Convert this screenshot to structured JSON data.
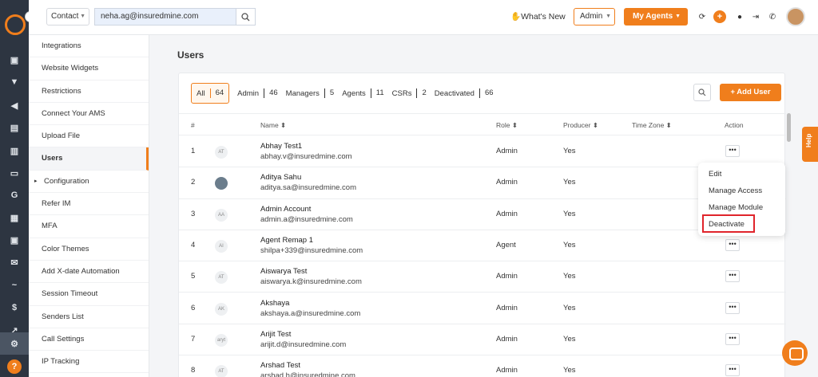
{
  "header": {
    "search_scope": "Contact",
    "search_value": "neha.ag@insuredmine.com",
    "whats_new": "What's New",
    "role": "Admin",
    "my_agents": "My Agents",
    "accent": "#f07e1c"
  },
  "settings_nav": [
    {
      "label": "Integrations"
    },
    {
      "label": "Website Widgets"
    },
    {
      "label": "Restrictions"
    },
    {
      "label": "Connect Your AMS"
    },
    {
      "label": "Upload File"
    },
    {
      "label": "Users",
      "active": true
    },
    {
      "label": "Configuration",
      "expandable": true
    },
    {
      "label": "Refer IM"
    },
    {
      "label": "MFA"
    },
    {
      "label": "Color Themes"
    },
    {
      "label": "Add X-date Automation"
    },
    {
      "label": "Session Timeout"
    },
    {
      "label": "Senders List"
    },
    {
      "label": "Call Settings"
    },
    {
      "label": "IP Tracking"
    }
  ],
  "page": {
    "title": "Users",
    "add_user": "Add User",
    "tabs": [
      {
        "label": "All",
        "count": "64"
      },
      {
        "label": "Admin",
        "count": "46"
      },
      {
        "label": "Managers",
        "count": "5"
      },
      {
        "label": "Agents",
        "count": "11"
      },
      {
        "label": "CSRs",
        "count": "2"
      },
      {
        "label": "Deactivated",
        "count": "66"
      }
    ]
  },
  "table": {
    "columns": [
      "#",
      "Name",
      "Role",
      "Producer",
      "Time Zone",
      "Action"
    ],
    "rows": [
      {
        "num": "1",
        "initials": "AT",
        "name": "Abhay Test1",
        "email": "abhay.v@insuredmine.com",
        "role": "Admin",
        "producer": "Yes"
      },
      {
        "num": "2",
        "initials": "",
        "name": "Aditya Sahu",
        "email": "aditya.sa@insuredmine.com",
        "role": "Admin",
        "producer": "Yes"
      },
      {
        "num": "3",
        "initials": "AA",
        "name": "Admin Account",
        "email": "admin.a@insuredmine.com",
        "role": "Admin",
        "producer": "Yes"
      },
      {
        "num": "4",
        "initials": "AI",
        "name": "Agent Remap 1",
        "email": "shilpa+339@insuredmine.com",
        "role": "Agent",
        "producer": "Yes"
      },
      {
        "num": "5",
        "initials": "AT",
        "name": "Aiswarya Test",
        "email": "aiswarya.k@insuredmine.com",
        "role": "Admin",
        "producer": "Yes"
      },
      {
        "num": "6",
        "initials": "AK",
        "name": "Akshaya",
        "email": "akshaya.a@insuredmine.com",
        "role": "Admin",
        "producer": "Yes"
      },
      {
        "num": "7",
        "initials": "aryt",
        "name": "Arijit Test",
        "email": "arijit.d@insuredmine.com",
        "role": "Admin",
        "producer": "Yes"
      },
      {
        "num": "8",
        "initials": "AT",
        "name": "Arshad Test",
        "email": "arshad.h@insuredmine.com",
        "role": "Admin",
        "producer": "Yes"
      }
    ]
  },
  "action_menu": {
    "items": [
      "Edit",
      "Manage Access",
      "Manage Module",
      "Deactivate"
    ],
    "highlighted": "Deactivate"
  },
  "help_tab": "Help"
}
